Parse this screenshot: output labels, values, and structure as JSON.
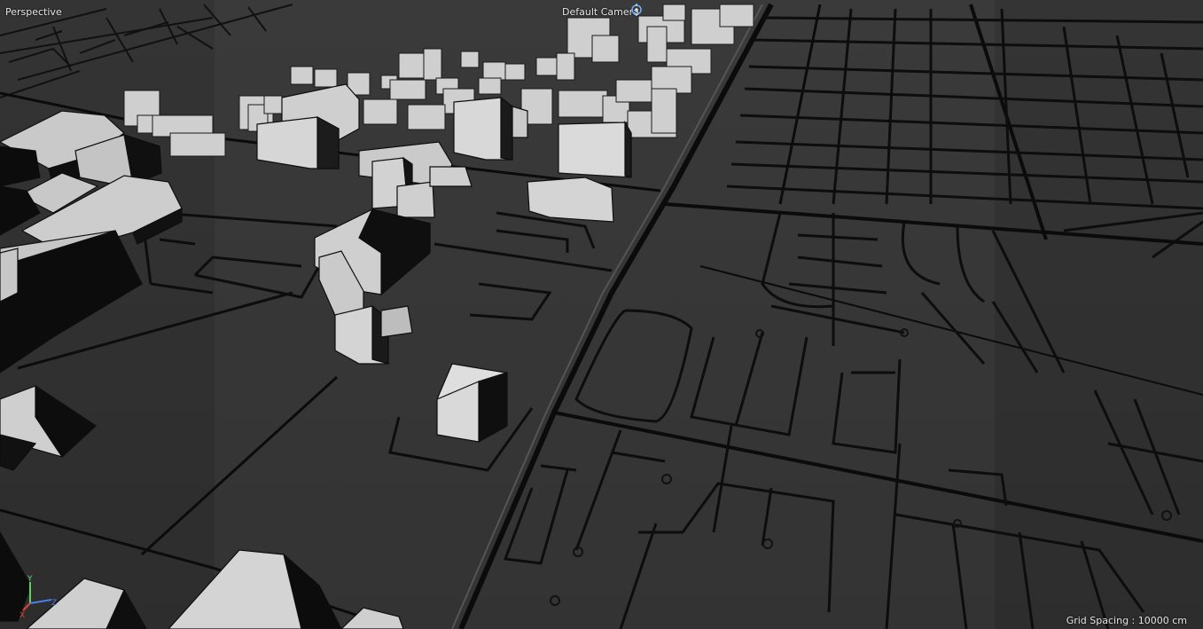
{
  "viewport": {
    "view_name": "Perspective",
    "camera_name": "Default Camera",
    "camera_icon": "camera-target-icon",
    "grid_spacing": "Grid Spacing : 10000 cm",
    "axis_labels": {
      "x": "X",
      "y": "Y",
      "z": "Z"
    }
  },
  "colors": {
    "ground": "#3b3b3b",
    "roads": "#0d0d0d",
    "building_top": "#d4d4d4",
    "building_side": "#bdbdbd",
    "building_shadow": "#141414",
    "axis_x": "#e0403a",
    "axis_y": "#5fd45a",
    "axis_z": "#4a7ee8"
  }
}
